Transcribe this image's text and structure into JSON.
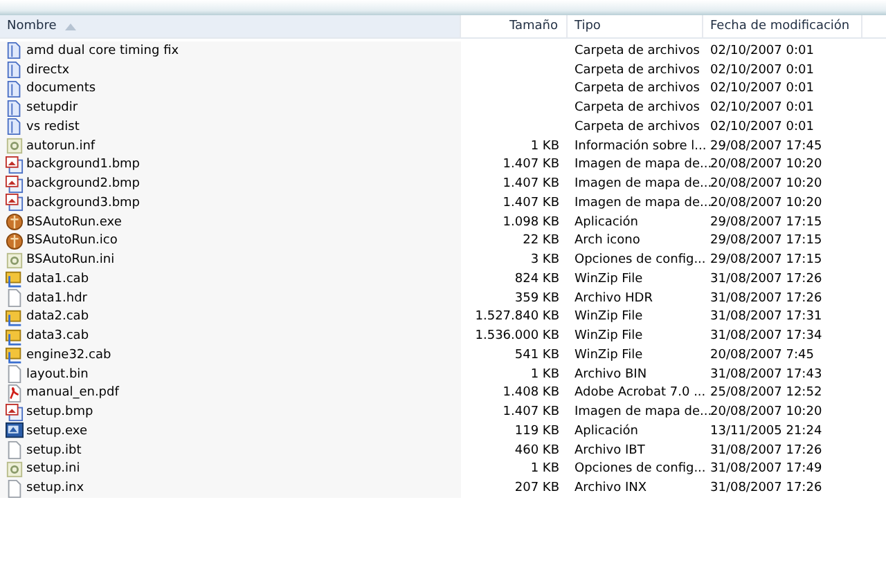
{
  "columns": [
    {
      "label": "Nombre",
      "sorted": true
    },
    {
      "label": "Tamaño",
      "sorted": false
    },
    {
      "label": "Tipo",
      "sorted": false
    },
    {
      "label": "Fecha de modificación",
      "sorted": false
    }
  ],
  "rows": [
    {
      "kind": "folder",
      "name": "amd dual core timing fix",
      "size": "",
      "type": "Carpeta de archivos",
      "date": "02/10/2007 0:01"
    },
    {
      "kind": "folder",
      "name": "directx",
      "size": "",
      "type": "Carpeta de archivos",
      "date": "02/10/2007 0:01"
    },
    {
      "kind": "folder",
      "name": "documents",
      "size": "",
      "type": "Carpeta de archivos",
      "date": "02/10/2007 0:01"
    },
    {
      "kind": "folder",
      "name": "setupdir",
      "size": "",
      "type": "Carpeta de archivos",
      "date": "02/10/2007 0:01"
    },
    {
      "kind": "folder",
      "name": "vs redist",
      "size": "",
      "type": "Carpeta de archivos",
      "date": "02/10/2007 0:01"
    },
    {
      "kind": "settings",
      "name": "autorun.inf",
      "size": "1 KB",
      "type": "Información sobre l...",
      "date": "29/08/2007 17:45"
    },
    {
      "kind": "image",
      "name": "background1.bmp",
      "size": "1.407 KB",
      "type": "Imagen de mapa de...",
      "date": "20/08/2007 10:20"
    },
    {
      "kind": "image",
      "name": "background2.bmp",
      "size": "1.407 KB",
      "type": "Imagen de mapa de...",
      "date": "20/08/2007 10:20"
    },
    {
      "kind": "image",
      "name": "background3.bmp",
      "size": "1.407 KB",
      "type": "Imagen de mapa de...",
      "date": "20/08/2007 10:20"
    },
    {
      "kind": "orb",
      "name": "BSAutoRun.exe",
      "size": "1.098 KB",
      "type": "Aplicación",
      "date": "29/08/2007 17:15"
    },
    {
      "kind": "orb",
      "name": "BSAutoRun.ico",
      "size": "22 KB",
      "type": "Arch icono",
      "date": "29/08/2007 17:15"
    },
    {
      "kind": "settings",
      "name": "BSAutoRun.ini",
      "size": "3 KB",
      "type": "Opciones de config...",
      "date": "29/08/2007 17:15"
    },
    {
      "kind": "archive",
      "name": "data1.cab",
      "size": "824 KB",
      "type": "WinZip File",
      "date": "31/08/2007 17:26"
    },
    {
      "kind": "blank",
      "name": "data1.hdr",
      "size": "359 KB",
      "type": "Archivo HDR",
      "date": "31/08/2007 17:26"
    },
    {
      "kind": "archive",
      "name": "data2.cab",
      "size": "1.527.840 KB",
      "type": "WinZip File",
      "date": "31/08/2007 17:31"
    },
    {
      "kind": "archive",
      "name": "data3.cab",
      "size": "1.536.000 KB",
      "type": "WinZip File",
      "date": "31/08/2007 17:34"
    },
    {
      "kind": "archive",
      "name": "engine32.cab",
      "size": "541 KB",
      "type": "WinZip File",
      "date": "20/08/2007 7:45"
    },
    {
      "kind": "blank",
      "name": "layout.bin",
      "size": "1 KB",
      "type": "Archivo BIN",
      "date": "31/08/2007 17:43"
    },
    {
      "kind": "pdf",
      "name": "manual_en.pdf",
      "size": "1.408 KB",
      "type": "Adobe Acrobat 7.0 ...",
      "date": "25/08/2007 12:52"
    },
    {
      "kind": "image",
      "name": "setup.bmp",
      "size": "1.407 KB",
      "type": "Imagen de mapa de...",
      "date": "20/08/2007 10:20"
    },
    {
      "kind": "installer",
      "name": "setup.exe",
      "size": "119 KB",
      "type": "Aplicación",
      "date": "13/11/2005 21:24"
    },
    {
      "kind": "blank",
      "name": "setup.ibt",
      "size": "460 KB",
      "type": "Archivo IBT",
      "date": "31/08/2007 17:26"
    },
    {
      "kind": "settings",
      "name": "setup.ini",
      "size": "1 KB",
      "type": "Opciones de config...",
      "date": "31/08/2007 17:49"
    },
    {
      "kind": "blank",
      "name": "setup.inx",
      "size": "207 KB",
      "type": "Archivo INX",
      "date": "31/08/2007 17:26"
    }
  ]
}
